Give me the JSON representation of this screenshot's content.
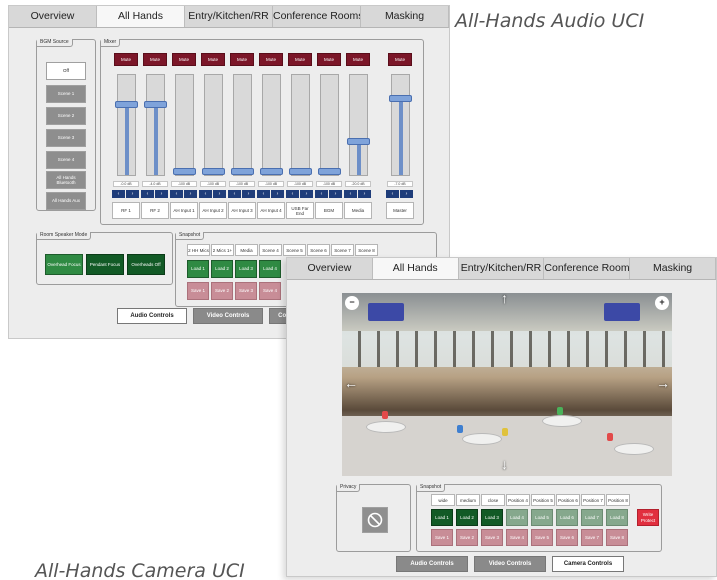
{
  "captions": {
    "audio": "All-Hands Audio UCI",
    "camera": "All-Hands Camera UCI"
  },
  "tabs": [
    "Overview",
    "All Hands",
    "Entry/Kitchen/RR",
    "Conference Rooms",
    "Masking"
  ],
  "active_tab": "All Hands",
  "audio": {
    "bgm": {
      "title": "BGM Source",
      "items": [
        "Off",
        "Scene 1",
        "Scene 2",
        "Scene 3",
        "Scene 4",
        "All Hands Bluetooth",
        "All Hands Aux"
      ],
      "selected": "Off"
    },
    "mixer": {
      "title": "Mixer",
      "mute_label": "Mute",
      "channels": [
        {
          "name": "RF 1",
          "db": "-0.0 dB",
          "level": 0.72
        },
        {
          "name": "RF 2",
          "db": "-4.0 dB",
          "level": 0.72
        },
        {
          "name": "AH Input 1",
          "db": "-100 dB",
          "level": 0.0
        },
        {
          "name": "AH Input 2",
          "db": "-100 dB",
          "level": 0.0
        },
        {
          "name": "AH Input 3",
          "db": "-100 dB",
          "level": 0.0
        },
        {
          "name": "AH Input 4",
          "db": "-100 dB",
          "level": 0.0
        },
        {
          "name": "USB Far End",
          "db": "-100 dB",
          "level": 0.0
        },
        {
          "name": "BGM",
          "db": "-100 dB",
          "level": 0.0
        },
        {
          "name": "Media",
          "db": "-20.0 dB",
          "level": 0.32
        }
      ],
      "master": {
        "name": "Master",
        "db": "-7.0 dB",
        "level": 0.78
      }
    },
    "room_speaker": {
      "title": "Room Speaker Mode",
      "items": [
        "Overhead Focus",
        "Pendant Focus",
        "Overheads Off"
      ]
    },
    "snapshot": {
      "title": "Snapshot",
      "headers": [
        "2 HH Mics",
        "2 Mics 1+",
        "Media",
        "Scene 4",
        "Scene 5",
        "Scene 6",
        "Scene 7",
        "Scene 8"
      ],
      "load": [
        "Load 1",
        "Load 2",
        "Load 3",
        "Load 4"
      ],
      "save": [
        "Save 1",
        "Save 2",
        "Save 3",
        "Save 4"
      ]
    },
    "bottom": [
      "Audio Controls",
      "Video Controls",
      "Con"
    ]
  },
  "camera": {
    "privacy_title": "Privacy",
    "snapshot": {
      "title": "Snapshot",
      "headers": [
        "wide",
        "medium",
        "close",
        "Position 4",
        "Position 5",
        "Position 6",
        "Position 7",
        "Position 8"
      ],
      "load": [
        "Load 1",
        "Load 2",
        "Load 3",
        "Load 4",
        "Load 5",
        "Load 6",
        "Load 7",
        "Load 8"
      ],
      "save": [
        "Save 1",
        "Save 2",
        "Save 3",
        "Save 4",
        "Save 5",
        "Save 6",
        "Save 7",
        "Save 8"
      ],
      "write_protect": "Write Protect"
    },
    "bottom": [
      "Audio Controls",
      "Video Controls",
      "Camera Controls"
    ],
    "bottom_active": "Camera Controls"
  },
  "colors": {
    "mute": "#7b1628",
    "load_active": "#2f8a43",
    "save": "#c88d97",
    "write_protect": "#e12f3f",
    "fader": "#7fa3da"
  }
}
